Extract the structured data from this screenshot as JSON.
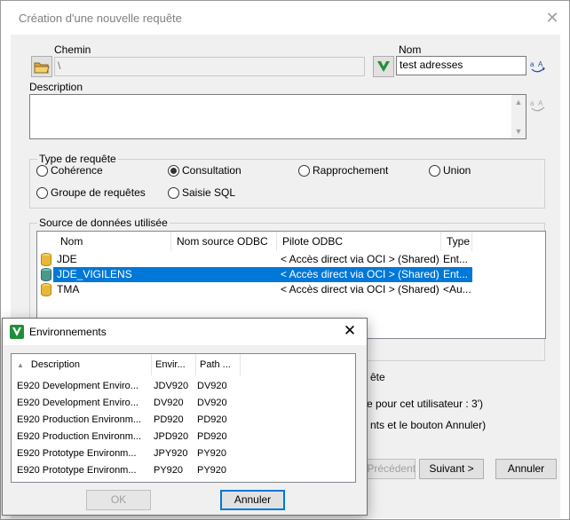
{
  "main": {
    "title": "Création d'une nouvelle requête",
    "chemin_label": "Chemin",
    "chemin_value": "\\",
    "nom_label": "Nom",
    "nom_value": "test adresses",
    "description_label": "Description",
    "description_value": "",
    "type_group_title": "Type de requête",
    "types": [
      {
        "label": "Cohérence",
        "checked": false
      },
      {
        "label": "Consultation",
        "checked": true
      },
      {
        "label": "Rapprochement",
        "checked": false
      },
      {
        "label": "Union",
        "checked": false
      },
      {
        "label": "Groupe de requêtes",
        "checked": false
      },
      {
        "label": "Saisie SQL",
        "checked": false
      }
    ],
    "source_group_title": "Source de données utilisée",
    "columns": [
      "Nom",
      "Nom source ODBC",
      "Pilote ODBC",
      "Type"
    ],
    "rows": [
      {
        "nom": "JDE",
        "odbc": "",
        "pilote": "< Accès direct via OCI > (Shared)",
        "type": "Ent...",
        "selected": false
      },
      {
        "nom": "JDE_VIGILENS",
        "odbc": "",
        "pilote": "< Accès direct via OCI > (Shared)",
        "type": "Ent...",
        "selected": true
      },
      {
        "nom": "TMA",
        "odbc": "",
        "pilote": "< Accès direct via OCI > (Shared)",
        "type": "<Au...",
        "selected": false
      }
    ],
    "hidden_text_1": "ête",
    "hidden_text_2": "e pour cet utilisateur :  3')",
    "hidden_text_3": "nts et le bouton Annuler)",
    "btn_precedent": "< Précédent",
    "btn_suivant": "Suivant >",
    "btn_annuler": "Annuler"
  },
  "env": {
    "title": "Environnements",
    "columns": [
      "Description",
      "Envir...",
      "Path ..."
    ],
    "rows": [
      {
        "desc": "E920 Development Enviro...",
        "env": "JDV920",
        "path": "DV920"
      },
      {
        "desc": "E920 Development Enviro...",
        "env": "DV920",
        "path": "DV920"
      },
      {
        "desc": "E920 Production Environm...",
        "env": "PD920",
        "path": "PD920"
      },
      {
        "desc": "E920 Production Environm...",
        "env": "JPD920",
        "path": "PD920"
      },
      {
        "desc": "E920 Prototype Environm...",
        "env": "JPY920",
        "path": "PY920"
      },
      {
        "desc": "E920 Prototype Environm...",
        "env": "PY920",
        "path": "PY920"
      }
    ],
    "btn_ok": "OK",
    "btn_annuler": "Annuler"
  },
  "colors": {
    "selection": "#0078d7",
    "db_gold": "#e8b83a",
    "db_teal": "#4a9a8c",
    "logo_green": "#1f8f3a"
  }
}
